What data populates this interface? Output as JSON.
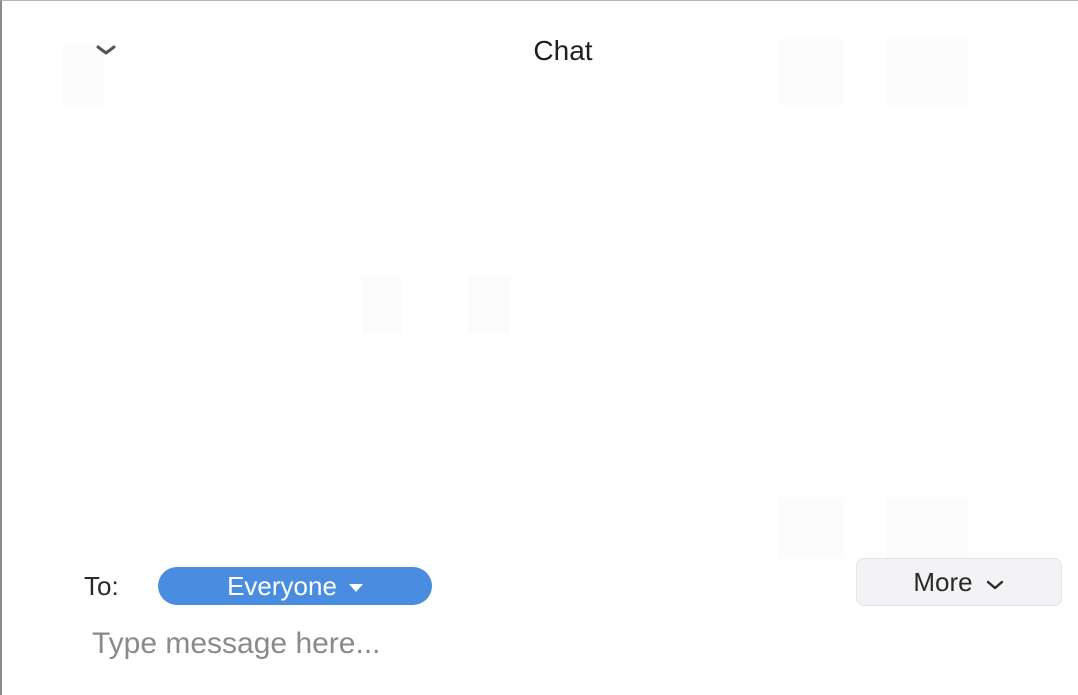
{
  "header": {
    "title": "Chat",
    "collapse_icon": "chevron-down-icon"
  },
  "composer": {
    "to_label": "To:",
    "recipient": "Everyone",
    "recipient_icon": "caret-down-icon",
    "more_label": "More",
    "more_icon": "chevron-down-icon",
    "input_value": "",
    "input_placeholder": "Type message here..."
  },
  "colors": {
    "accent": "#4a8de0",
    "background": "#ffffff",
    "button_bg": "#f3f3f5"
  }
}
